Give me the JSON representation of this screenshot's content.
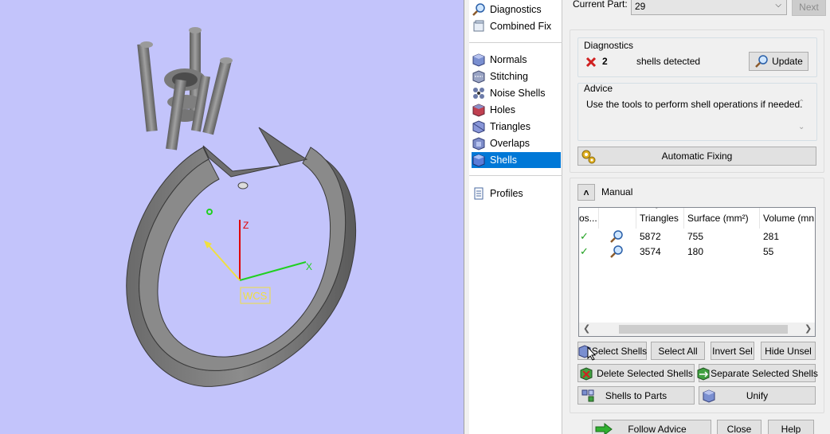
{
  "viewport": {
    "axes": {
      "z": "Z",
      "x": "X",
      "wcs": "WCS"
    },
    "colors": {
      "background": "#c3c4fb",
      "model": "#787878",
      "axis_z": "#e00000",
      "axis_x": "#20d020",
      "axis_y": "#f0e040"
    }
  },
  "tools": [
    {
      "label": "Diagnostics",
      "icon": "magnifier-icon",
      "selected": false
    },
    {
      "label": "Combined Fix",
      "icon": "combined-fix-icon",
      "selected": false
    },
    {
      "label": "Normals",
      "icon": "cube-normals-icon",
      "selected": false
    },
    {
      "label": "Stitching",
      "icon": "cube-stitching-icon",
      "selected": false
    },
    {
      "label": "Noise Shells",
      "icon": "noise-shells-icon",
      "selected": false
    },
    {
      "label": "Holes",
      "icon": "cube-holes-icon",
      "selected": false
    },
    {
      "label": "Triangles",
      "icon": "cube-triangles-icon",
      "selected": false
    },
    {
      "label": "Overlaps",
      "icon": "cube-overlaps-icon",
      "selected": false
    },
    {
      "label": "Shells",
      "icon": "cube-shells-icon",
      "selected": true
    },
    {
      "label": "Profiles",
      "icon": "document-icon",
      "selected": false
    }
  ],
  "panel": {
    "current_part_label": "Current Part:",
    "current_part_value": "29",
    "next_label": "Next",
    "diagnostics": {
      "title": "Diagnostics",
      "count": "2",
      "status_text": "shells detected",
      "update_label": "Update"
    },
    "advice": {
      "title": "Advice",
      "text": "Use the tools to perform shell operations if needed."
    },
    "automatic_fixing_label": "Automatic Fixing",
    "manual_label": "Manual",
    "table": {
      "headers": [
        "os...",
        "",
        "Triangles",
        "Surface (mm²)",
        "Volume (mn"
      ],
      "rows": [
        {
          "triangles": "5872",
          "surface": "755",
          "volume": "281"
        },
        {
          "triangles": "3574",
          "surface": "180",
          "volume": "55"
        }
      ]
    },
    "buttons": {
      "select_shells": "Select Shells",
      "select_all": "Select All",
      "invert_sel": "Invert Sel",
      "hide_unsel": "Hide Unsel",
      "delete_selected": "Delete Selected Shells",
      "separate_selected": "Separate Selected Shells",
      "shells_to_parts": "Shells to Parts",
      "unify": "Unify",
      "follow_advice": "Follow Advice",
      "close": "Close",
      "help": "Help"
    }
  }
}
